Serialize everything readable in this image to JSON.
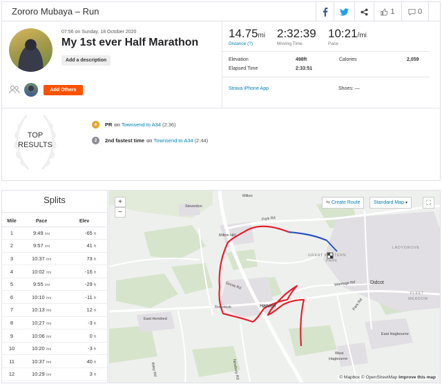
{
  "header": {
    "title": "Zororo Mubaya – Run",
    "kudos_count": "1",
    "comment_count": "0"
  },
  "activity": {
    "date": "07:56 on Sunday, 18 October 2020",
    "name": "My 1st ever Half Marathon",
    "description_button": "Add a description",
    "add_others_button": "Add Others"
  },
  "stats": {
    "distance_value": "14.75",
    "distance_unit": "mi",
    "distance_label": "Distance (?)",
    "moving_time_value": "2:32:39",
    "moving_time_label": "Moving Time",
    "pace_value": "10:21",
    "pace_unit": "/mi",
    "pace_label": "Pace",
    "elevation_label": "Elevation",
    "elevation_value": "498ft",
    "calories_label": "Calories",
    "calories_value": "2,059",
    "elapsed_label": "Elapsed Time",
    "elapsed_value": "2:33:51",
    "device": "Strava iPhone App",
    "shoes": "Shoes: —"
  },
  "top_results": {
    "title_line1": "TOP",
    "title_line2": "RESULTS",
    "achievements": [
      {
        "prefix": "PR",
        "on": "on",
        "segment": "Townsend to A34",
        "time": "(2:36)",
        "medal_color": "#e3a52c"
      },
      {
        "prefix": "2nd fastest time",
        "on": "on",
        "segment": "Townsend to A34",
        "time": "(2:44)",
        "medal_color": "#8e8e94"
      }
    ]
  },
  "splits": {
    "title": "Splits",
    "columns": [
      "Mile",
      "Pace",
      "Elev"
    ],
    "pace_unit": "/mi",
    "elev_unit": "ft",
    "rows": [
      {
        "mile": "1",
        "pace": "9:49",
        "elev": "-65"
      },
      {
        "mile": "2",
        "pace": "9:57",
        "elev": "41"
      },
      {
        "mile": "3",
        "pace": "10:37",
        "elev": "73"
      },
      {
        "mile": "4",
        "pace": "10:02",
        "elev": "-16"
      },
      {
        "mile": "5",
        "pace": "9:55",
        "elev": "-29"
      },
      {
        "mile": "6",
        "pace": "10:10",
        "elev": "-11"
      },
      {
        "mile": "7",
        "pace": "10:13",
        "elev": "12"
      },
      {
        "mile": "8",
        "pace": "10:27",
        "elev": "-3"
      },
      {
        "mile": "9",
        "pace": "10:06",
        "elev": "0"
      },
      {
        "mile": "10",
        "pace": "10:20",
        "elev": "-3"
      },
      {
        "mile": "11",
        "pace": "10:37",
        "elev": "40"
      },
      {
        "mile": "12",
        "pace": "10:29",
        "elev": "3"
      }
    ]
  },
  "map": {
    "zoom_in": "+",
    "zoom_out": "−",
    "create_route": "Create Route",
    "map_type": "Standard Map",
    "fullscreen": "⛶",
    "attribution_mapbox": "© Mapbox",
    "attribution_osm": "© OpenStreetMap",
    "improve": "Improve this map",
    "route_color": "#e5202e",
    "route_end_color": "#2a52be",
    "places": {
      "milton": "Milton",
      "steventon": "Steventon",
      "park_rd": "Park Rd",
      "milton_hill": "Milton Hill",
      "great_western": "GREAT WESTERN",
      "park": "PARK",
      "ladygrove": "LADYGROVE",
      "wantage_rd": "Wantage Rd",
      "didcot": "Didcot",
      "fleet": "FLEET",
      "meadow": "MEADOW",
      "grove_rd": "Grove Rd",
      "rowstock": "Rowstock",
      "harwell": "Harwell",
      "park_rd2": "Park Rd",
      "east_hendred": "East Hendred",
      "east_hagbourne": "East Hagbourne",
      "west": "West",
      "hagbourne": "Hagbourne",
      "newbury_rd": "Newbury Rd",
      "ilsley_rd": "Ilsley Rd",
      "a34": "A34"
    }
  }
}
